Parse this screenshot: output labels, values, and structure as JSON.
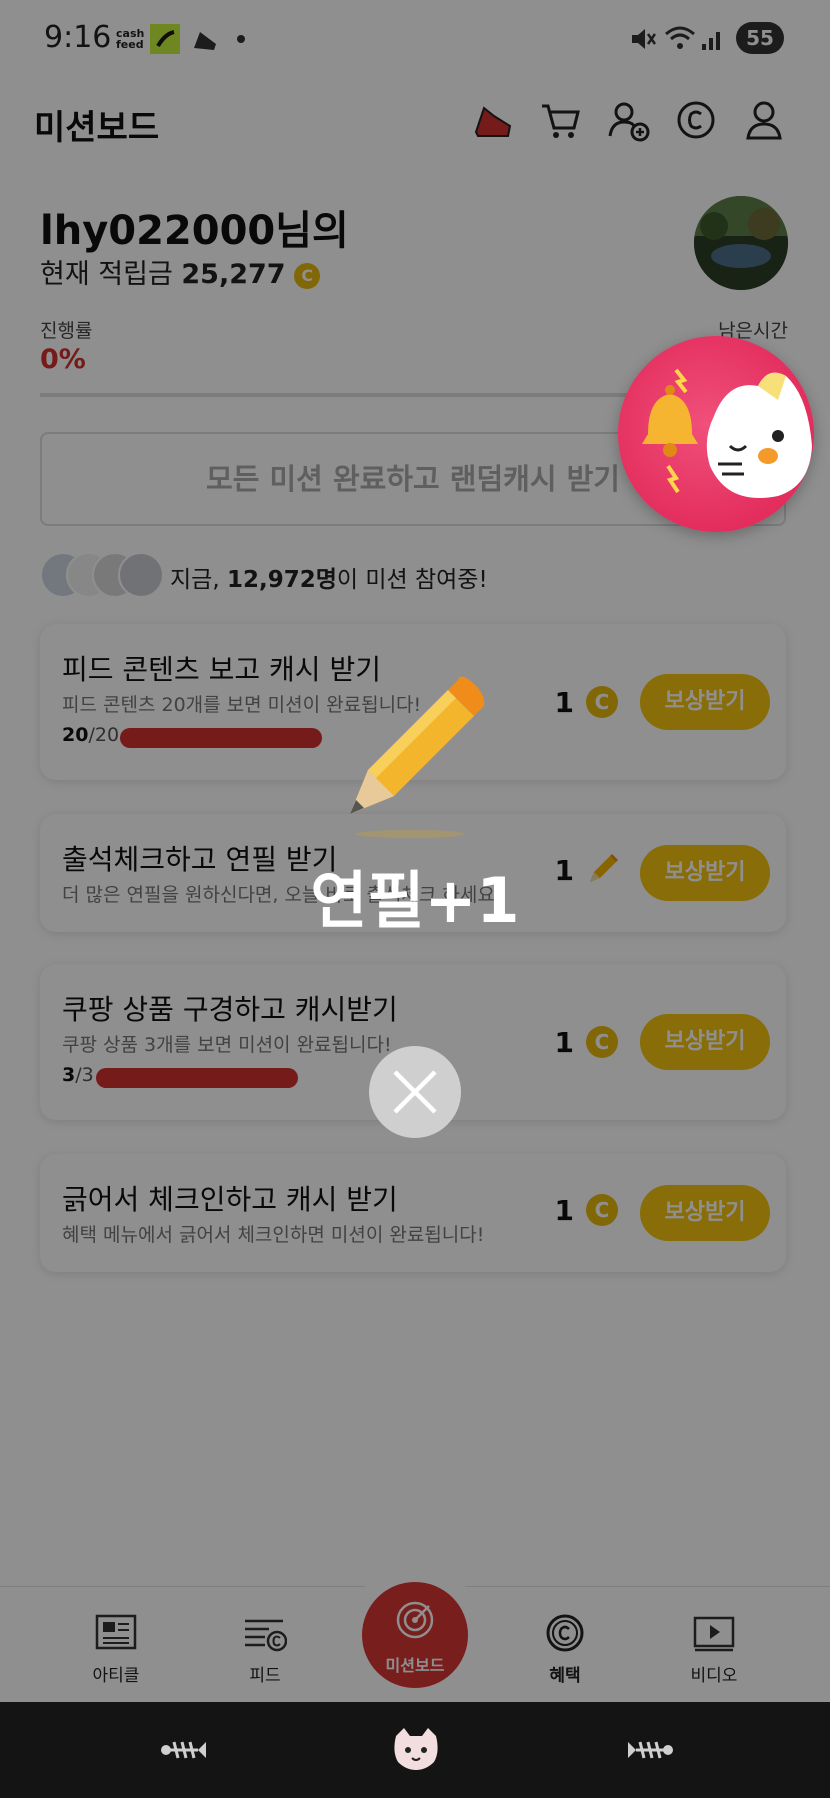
{
  "status_bar": {
    "time": "9:16",
    "app_logo_line1": "cash",
    "app_logo_line2": "feed",
    "battery": "55"
  },
  "header": {
    "title": "미션보드"
  },
  "profile": {
    "name": "lhy022000님의",
    "balance_label": "현재 적립금",
    "balance_value": "25,277",
    "coin_symbol": "C"
  },
  "progress": {
    "label": "진행률",
    "value": "0%",
    "remaining_label": "남은시간"
  },
  "all_mission_banner": "모든 미션 완료하고 랜덤캐시 받기",
  "participants": {
    "prefix": "지금,",
    "count": "12,972명",
    "suffix": "이 미션 참여중!"
  },
  "missions": [
    {
      "title": "피드 콘텐츠 보고 캐시 받기",
      "description": "피드 콘텐츠 20개를 보면 미션이 완료됩니다!",
      "done": "20",
      "total": "/20",
      "progress_fraction": 1.0,
      "reward_amount": "1",
      "reward_type": "coin",
      "button": "보상받기"
    },
    {
      "title": "출석체크하고 연필 받기",
      "description": "더 많은 연필을 원하신다면, 오늘 바로 출석체크 하세요",
      "reward_amount": "1",
      "reward_type": "pencil",
      "button": "보상받기"
    },
    {
      "title": "쿠팡 상품 구경하고 캐시받기",
      "description": "쿠팡 상품 3개를 보면 미션이 완료됩니다!",
      "done": "3",
      "total": "/3",
      "progress_fraction": 1.0,
      "reward_amount": "1",
      "reward_type": "coin",
      "button": "보상받기"
    },
    {
      "title": "긁어서 체크인하고 캐시 받기",
      "description": "혜택 메뉴에서 긁어서 체크인하면 미션이 완료됩니다!",
      "reward_amount": "1",
      "reward_type": "coin",
      "button": "보상받기"
    }
  ],
  "tabs": {
    "article": "아티클",
    "feed": "피드",
    "missionboard": "미션보드",
    "benefit": "혜택",
    "video": "비디오"
  },
  "popup": {
    "text": "연필+1"
  },
  "colors": {
    "accent_red": "#d0302f",
    "coin_yellow": "#e8b80e",
    "button_yellow": "#f5c30f",
    "badge_pink": "#e32d5d"
  }
}
